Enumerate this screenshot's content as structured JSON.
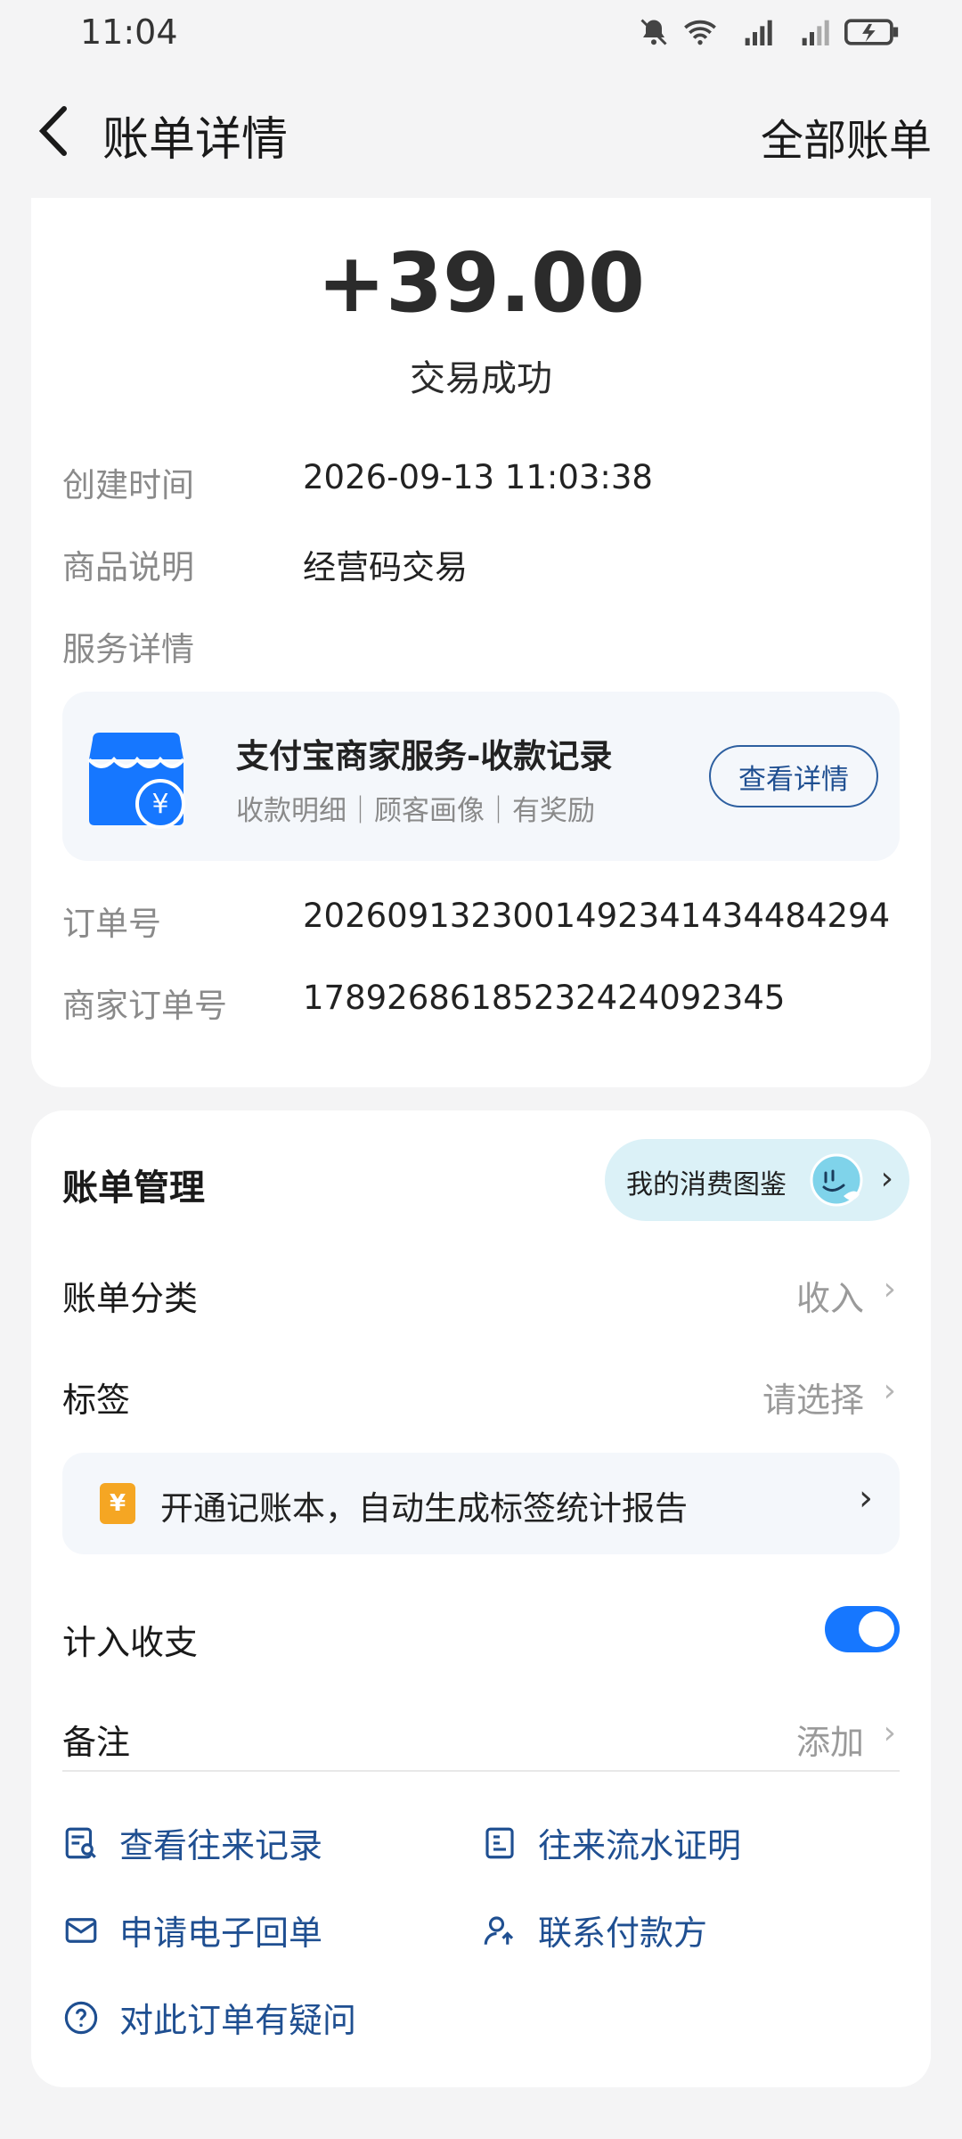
{
  "status_bar": {
    "time": "11:04",
    "icons": [
      "bell-mute-icon",
      "wifi-icon",
      "signal-5g-icon",
      "signal-4g-icon",
      "battery-icon"
    ]
  },
  "nav": {
    "title": "账单详情",
    "right_link": "全部账单"
  },
  "transaction": {
    "amount": "+39.00",
    "status": "交易成功",
    "created_label": "创建时间",
    "created_value": "2026-09-13 11:03:38",
    "item_label": "商品说明",
    "item_value": "经营码交易",
    "service_label": "服务详情",
    "order_label": "订单号",
    "order_value": "2026091323001492341434484294",
    "merchant_order_label": "商家订单号",
    "merchant_order_value": "17892686185232424092345"
  },
  "service_card": {
    "title": "支付宝商家服务-收款记录",
    "subtitle": "收款明细｜顾客画像｜有奖励",
    "button": "查看详情",
    "logo_symbol": "¥"
  },
  "management": {
    "title": "账单管理",
    "pill_label": "我的消费图鉴",
    "category_label": "账单分类",
    "category_value": "收入",
    "tag_label": "标签",
    "tag_value": "请选择",
    "tip_badge": "¥",
    "tip_text": "开通记账本，自动生成标签统计报告",
    "count_label": "计入收支",
    "count_enabled": true,
    "note_label": "备注",
    "note_value": "添加"
  },
  "actions": {
    "history": "查看往来记录",
    "proof": "往来流水证明",
    "receipt": "申请电子回单",
    "contact": "联系付款方",
    "question": "对此订单有疑问"
  },
  "colors": {
    "accent_blue": "#1677ff",
    "link_blue": "#1f4f91",
    "page_bg": "#f4f4f5"
  }
}
